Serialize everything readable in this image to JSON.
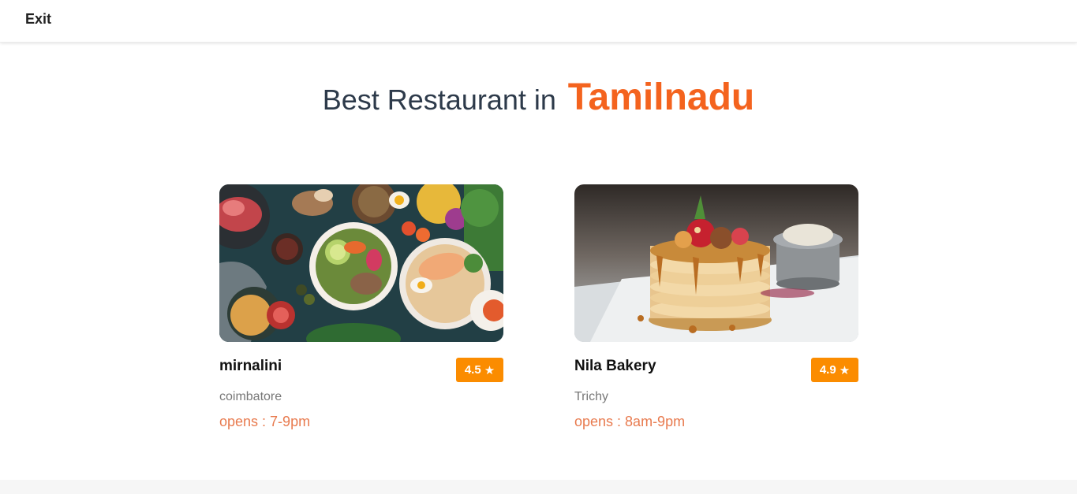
{
  "nav": {
    "exit_label": "Exit"
  },
  "headline": {
    "lead": "Best Restaurant in",
    "accent": "Tamilnadu"
  },
  "colors": {
    "accent": "#f4631e",
    "rating_badge": "#fb8c00",
    "hours_text": "#e87a4e",
    "heading_text": "#2d3a4a"
  },
  "restaurants": [
    {
      "name": "mirnalini",
      "rating": "4.5",
      "rating_icon": "star-icon",
      "city": "coimbatore",
      "hours_label": "opens : ",
      "hours": "7-9pm",
      "photo_icon": "food-platter-photo"
    },
    {
      "name": "Nila Bakery",
      "rating": "4.9",
      "rating_icon": "star-icon",
      "city": "Trichy",
      "hours_label": "opens : ",
      "hours": "8am-9pm",
      "photo_icon": "pancake-stack-photo"
    }
  ]
}
